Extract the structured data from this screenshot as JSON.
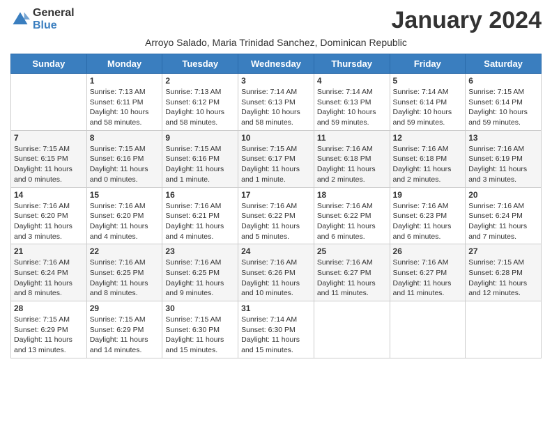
{
  "logo": {
    "general": "General",
    "blue": "Blue"
  },
  "title": "January 2024",
  "subtitle": "Arroyo Salado, Maria Trinidad Sanchez, Dominican Republic",
  "days_of_week": [
    "Sunday",
    "Monday",
    "Tuesday",
    "Wednesday",
    "Thursday",
    "Friday",
    "Saturday"
  ],
  "weeks": [
    [
      {
        "day": "",
        "info": ""
      },
      {
        "day": "1",
        "info": "Sunrise: 7:13 AM\nSunset: 6:11 PM\nDaylight: 10 hours\nand 58 minutes."
      },
      {
        "day": "2",
        "info": "Sunrise: 7:13 AM\nSunset: 6:12 PM\nDaylight: 10 hours\nand 58 minutes."
      },
      {
        "day": "3",
        "info": "Sunrise: 7:14 AM\nSunset: 6:13 PM\nDaylight: 10 hours\nand 58 minutes."
      },
      {
        "day": "4",
        "info": "Sunrise: 7:14 AM\nSunset: 6:13 PM\nDaylight: 10 hours\nand 59 minutes."
      },
      {
        "day": "5",
        "info": "Sunrise: 7:14 AM\nSunset: 6:14 PM\nDaylight: 10 hours\nand 59 minutes."
      },
      {
        "day": "6",
        "info": "Sunrise: 7:15 AM\nSunset: 6:14 PM\nDaylight: 10 hours\nand 59 minutes."
      }
    ],
    [
      {
        "day": "7",
        "info": "Sunrise: 7:15 AM\nSunset: 6:15 PM\nDaylight: 11 hours\nand 0 minutes."
      },
      {
        "day": "8",
        "info": "Sunrise: 7:15 AM\nSunset: 6:16 PM\nDaylight: 11 hours\nand 0 minutes."
      },
      {
        "day": "9",
        "info": "Sunrise: 7:15 AM\nSunset: 6:16 PM\nDaylight: 11 hours\nand 1 minute."
      },
      {
        "day": "10",
        "info": "Sunrise: 7:15 AM\nSunset: 6:17 PM\nDaylight: 11 hours\nand 1 minute."
      },
      {
        "day": "11",
        "info": "Sunrise: 7:16 AM\nSunset: 6:18 PM\nDaylight: 11 hours\nand 2 minutes."
      },
      {
        "day": "12",
        "info": "Sunrise: 7:16 AM\nSunset: 6:18 PM\nDaylight: 11 hours\nand 2 minutes."
      },
      {
        "day": "13",
        "info": "Sunrise: 7:16 AM\nSunset: 6:19 PM\nDaylight: 11 hours\nand 3 minutes."
      }
    ],
    [
      {
        "day": "14",
        "info": "Sunrise: 7:16 AM\nSunset: 6:20 PM\nDaylight: 11 hours\nand 3 minutes."
      },
      {
        "day": "15",
        "info": "Sunrise: 7:16 AM\nSunset: 6:20 PM\nDaylight: 11 hours\nand 4 minutes."
      },
      {
        "day": "16",
        "info": "Sunrise: 7:16 AM\nSunset: 6:21 PM\nDaylight: 11 hours\nand 4 minutes."
      },
      {
        "day": "17",
        "info": "Sunrise: 7:16 AM\nSunset: 6:22 PM\nDaylight: 11 hours\nand 5 minutes."
      },
      {
        "day": "18",
        "info": "Sunrise: 7:16 AM\nSunset: 6:22 PM\nDaylight: 11 hours\nand 6 minutes."
      },
      {
        "day": "19",
        "info": "Sunrise: 7:16 AM\nSunset: 6:23 PM\nDaylight: 11 hours\nand 6 minutes."
      },
      {
        "day": "20",
        "info": "Sunrise: 7:16 AM\nSunset: 6:24 PM\nDaylight: 11 hours\nand 7 minutes."
      }
    ],
    [
      {
        "day": "21",
        "info": "Sunrise: 7:16 AM\nSunset: 6:24 PM\nDaylight: 11 hours\nand 8 minutes."
      },
      {
        "day": "22",
        "info": "Sunrise: 7:16 AM\nSunset: 6:25 PM\nDaylight: 11 hours\nand 8 minutes."
      },
      {
        "day": "23",
        "info": "Sunrise: 7:16 AM\nSunset: 6:25 PM\nDaylight: 11 hours\nand 9 minutes."
      },
      {
        "day": "24",
        "info": "Sunrise: 7:16 AM\nSunset: 6:26 PM\nDaylight: 11 hours\nand 10 minutes."
      },
      {
        "day": "25",
        "info": "Sunrise: 7:16 AM\nSunset: 6:27 PM\nDaylight: 11 hours\nand 11 minutes."
      },
      {
        "day": "26",
        "info": "Sunrise: 7:16 AM\nSunset: 6:27 PM\nDaylight: 11 hours\nand 11 minutes."
      },
      {
        "day": "27",
        "info": "Sunrise: 7:15 AM\nSunset: 6:28 PM\nDaylight: 11 hours\nand 12 minutes."
      }
    ],
    [
      {
        "day": "28",
        "info": "Sunrise: 7:15 AM\nSunset: 6:29 PM\nDaylight: 11 hours\nand 13 minutes."
      },
      {
        "day": "29",
        "info": "Sunrise: 7:15 AM\nSunset: 6:29 PM\nDaylight: 11 hours\nand 14 minutes."
      },
      {
        "day": "30",
        "info": "Sunrise: 7:15 AM\nSunset: 6:30 PM\nDaylight: 11 hours\nand 15 minutes."
      },
      {
        "day": "31",
        "info": "Sunrise: 7:14 AM\nSunset: 6:30 PM\nDaylight: 11 hours\nand 15 minutes."
      },
      {
        "day": "",
        "info": ""
      },
      {
        "day": "",
        "info": ""
      },
      {
        "day": "",
        "info": ""
      }
    ]
  ]
}
